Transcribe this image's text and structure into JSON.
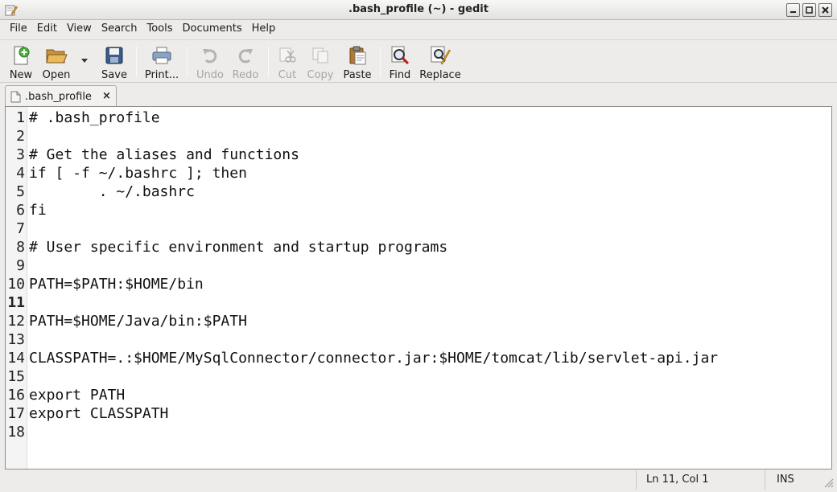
{
  "window": {
    "title": ".bash_profile (~) - gedit"
  },
  "menu": [
    "File",
    "Edit",
    "View",
    "Search",
    "Tools",
    "Documents",
    "Help"
  ],
  "toolbar": {
    "new": "New",
    "open": "Open",
    "save": "Save",
    "print": "Print...",
    "undo": "Undo",
    "redo": "Redo",
    "cut": "Cut",
    "copy": "Copy",
    "paste": "Paste",
    "find": "Find",
    "replace": "Replace"
  },
  "tab": {
    "label": ".bash_profile",
    "close": "×"
  },
  "editor": {
    "lines": [
      {
        "n": "1",
        "text": "# .bash_profile"
      },
      {
        "n": "2",
        "text": ""
      },
      {
        "n": "3",
        "text": "# Get the aliases and functions"
      },
      {
        "n": "4",
        "text": "if [ -f ~/.bashrc ]; then"
      },
      {
        "n": "5",
        "text": "        . ~/.bashrc"
      },
      {
        "n": "6",
        "text": "fi"
      },
      {
        "n": "7",
        "text": ""
      },
      {
        "n": "8",
        "text": "# User specific environment and startup programs"
      },
      {
        "n": "9",
        "text": ""
      },
      {
        "n": "10",
        "text": "PATH=$PATH:$HOME/bin"
      },
      {
        "n": "11",
        "text": ""
      },
      {
        "n": "12",
        "text": "PATH=$HOME/Java/bin:$PATH"
      },
      {
        "n": "13",
        "text": ""
      },
      {
        "n": "14",
        "text": "CLASSPATH=.:$HOME/MySqlConnector/connector.jar:$HOME/tomcat/lib/servlet-api.jar"
      },
      {
        "n": "15",
        "text": ""
      },
      {
        "n": "16",
        "text": "export PATH"
      },
      {
        "n": "17",
        "text": "export CLASSPATH"
      },
      {
        "n": "18",
        "text": ""
      }
    ],
    "current_line": "11"
  },
  "status": {
    "position": "Ln 11, Col 1",
    "mode": "INS"
  }
}
